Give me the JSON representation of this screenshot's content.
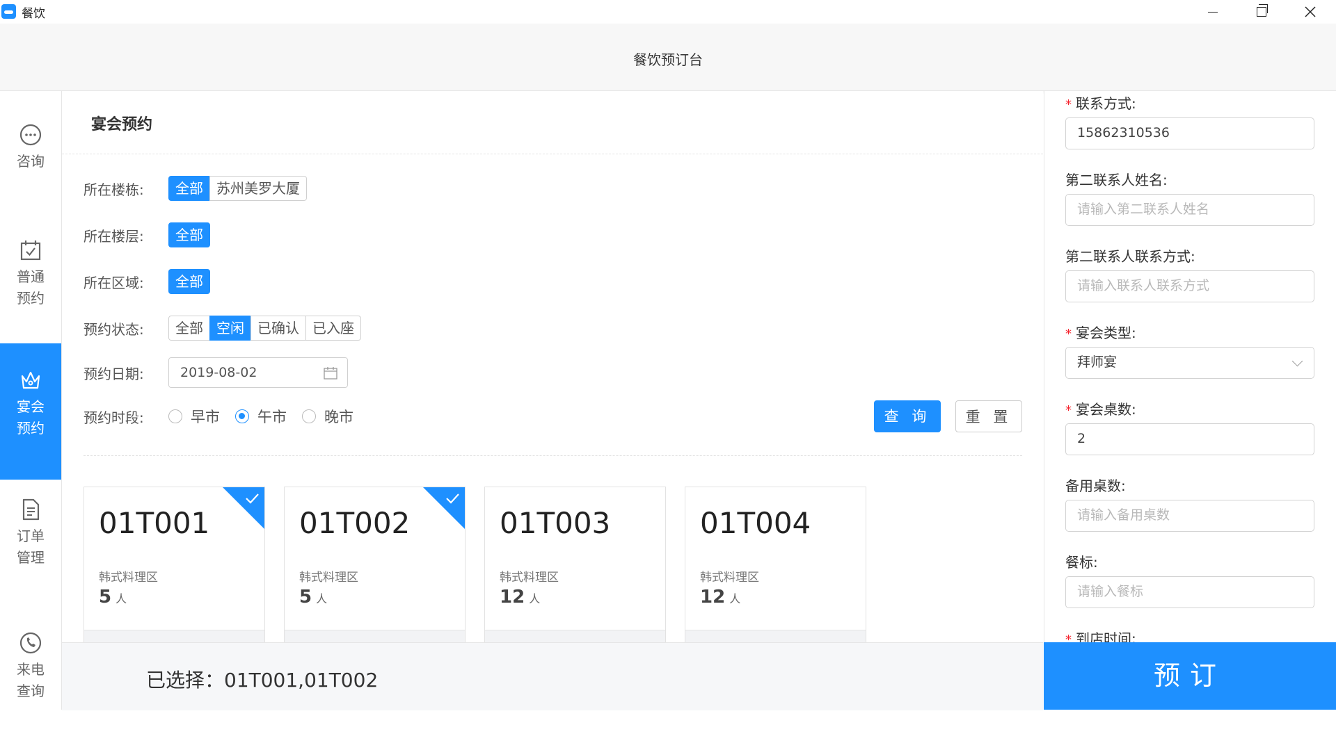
{
  "window": {
    "title": "餐饮"
  },
  "header": {
    "title": "餐饮预订台"
  },
  "sidebar": {
    "items": [
      {
        "label": "咨询",
        "icon": "chat-icon",
        "active": false
      },
      {
        "label": "普通预约",
        "icon": "calendar-check-icon",
        "active": false
      },
      {
        "label": "宴会预约",
        "icon": "crown-icon",
        "active": true
      },
      {
        "label": "订单管理",
        "icon": "document-icon",
        "active": false
      },
      {
        "label": "来电查询",
        "icon": "phone-icon",
        "active": false
      }
    ]
  },
  "main": {
    "title": "宴会预约",
    "filters": {
      "building": {
        "label": "所在楼栋:",
        "options": [
          "全部",
          "苏州美罗大厦"
        ],
        "selected": "全部"
      },
      "floor": {
        "label": "所在楼层:",
        "options": [
          "全部"
        ],
        "selected": "全部"
      },
      "zone": {
        "label": "所在区域:",
        "options": [
          "全部"
        ],
        "selected": "全部"
      },
      "status": {
        "label": "预约状态:",
        "options": [
          "全部",
          "空闲",
          "已确认",
          "已入座"
        ],
        "selected": "空闲"
      },
      "date": {
        "label": "预约日期:",
        "value": "2019-08-02"
      },
      "period": {
        "label": "预约时段:",
        "options": [
          "早市",
          "午市",
          "晚市"
        ],
        "selected": "午市"
      }
    },
    "query_label": "查 询",
    "reset_label": "重 置",
    "tables": [
      {
        "code": "01T001",
        "area": "韩式料理区",
        "capacity": "5",
        "unit": "人",
        "selected": true
      },
      {
        "code": "01T002",
        "area": "韩式料理区",
        "capacity": "5",
        "unit": "人",
        "selected": true
      },
      {
        "code": "01T003",
        "area": "韩式料理区",
        "capacity": "12",
        "unit": "人",
        "selected": false
      },
      {
        "code": "01T004",
        "area": "韩式料理区",
        "capacity": "12",
        "unit": "人",
        "selected": false
      }
    ]
  },
  "bottom": {
    "selected_text": "已选择：01T001,01T002",
    "book_label": "预订"
  },
  "form": {
    "contact": {
      "label": "联系方式:",
      "value": "15862310536",
      "required": true
    },
    "second_name": {
      "label": "第二联系人姓名:",
      "placeholder": "请输入第二联系人姓名"
    },
    "second_contact": {
      "label": "第二联系人联系方式:",
      "placeholder": "请输入联系人联系方式"
    },
    "banquet_type": {
      "label": "宴会类型:",
      "value": "拜师宴",
      "required": true
    },
    "table_count": {
      "label": "宴会桌数:",
      "value": "2",
      "required": true
    },
    "spare_tables": {
      "label": "备用桌数:",
      "placeholder": "请输入备用桌数"
    },
    "meal_standard": {
      "label": "餐标:",
      "placeholder": "请输入餐标"
    },
    "arrival_time": {
      "label": "到店时间:",
      "required": true
    }
  },
  "colors": {
    "accent": "#1e90ff",
    "required": "#f5222d"
  }
}
